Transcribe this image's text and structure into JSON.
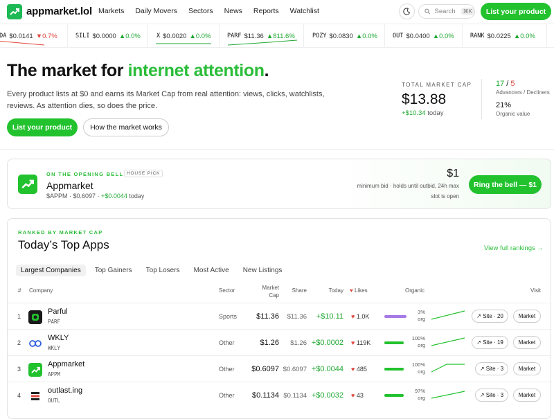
{
  "nav": {
    "brand": "appmarket.lol",
    "links": [
      "Markets",
      "Daily Movers",
      "Sectors",
      "News",
      "Reports",
      "Watchlist"
    ],
    "search_placeholder": "Search",
    "search_shortcut": "⌘K",
    "cta": "List your product"
  },
  "ticker": [
    {
      "sym": "QDA",
      "price": "$0.0141",
      "change": "▼0.7%",
      "dir": "down"
    },
    {
      "sym": "SILI",
      "price": "$0.0000",
      "change": "▲0.0%",
      "dir": "up"
    },
    {
      "sym": "X",
      "price": "$0.0020",
      "change": "▲0.0%",
      "dir": "up"
    },
    {
      "sym": "PARF",
      "price": "$11.36",
      "change": "▲811.6%",
      "dir": "up"
    },
    {
      "sym": "POZY",
      "price": "$0.0830",
      "change": "▲0.0%",
      "dir": "up"
    },
    {
      "sym": "OUT",
      "price": "$0.0400",
      "change": "▲0.0%",
      "dir": "up"
    },
    {
      "sym": "RANK",
      "price": "$0.0225",
      "change": "▲0.0%",
      "dir": "up"
    }
  ],
  "hero": {
    "title_prefix": "The market for ",
    "title_highlight": "internet attention",
    "title_suffix": ".",
    "subtitle": "Every product lists at $0 and earns its Market Cap from real attention: views, clicks, watchlists, reviews. As attention dies, so does the price.",
    "primary_cta": "List your product",
    "secondary_cta": "How the market works"
  },
  "stats": {
    "market_cap_label": "TOTAL MARKET CAP",
    "market_cap": "$13.88",
    "market_cap_change": "+$10.34",
    "market_cap_period": "today",
    "advancers": "17",
    "decliners": "5",
    "adv_label": "Advancers / Decliners",
    "organic": "21%",
    "organic_label": "Organic value"
  },
  "bell": {
    "kicker": "ON THE OPENING BELL",
    "badge": "HOUSE PICK",
    "name": "Appmarket",
    "ticker": "$APPM",
    "price": "$0.6097",
    "change": "+$0.0044",
    "period": "today",
    "bid": "$1",
    "note1": "minimum bid · holds until outbid, 24h max",
    "note2": "slot is open",
    "cta": "Ring the bell — $1"
  },
  "rankings": {
    "kicker": "RANKED BY MARKET CAP",
    "title": "Today’s Top Apps",
    "link": "View full rankings →",
    "tabs": [
      "Largest Companies",
      "Top Gainers",
      "Top Losers",
      "Most Active",
      "New Listings"
    ],
    "headers": {
      "rank": "#",
      "company": "Company",
      "sector": "Sector",
      "mcap1": "Market",
      "mcap2": "Cap",
      "share": "Share",
      "today": "Today",
      "likes": "Likes",
      "organic": "Organic",
      "visit": "Visit"
    },
    "rows": [
      {
        "rank": "1",
        "name": "Parful",
        "ticker": "PARF",
        "sector": "Sports",
        "mcap": "$11.36",
        "share": "$11.36",
        "today": "+$10.11",
        "likes": "1.0K",
        "organic_pct": "3%",
        "organic_fraction": 0.03,
        "org_label": "org",
        "site": "↗ Site · 20",
        "market": "Market",
        "bar_color": "#a678e6"
      },
      {
        "rank": "2",
        "name": "WKLY",
        "ticker": "WKLY",
        "sector": "Other",
        "mcap": "$1.26",
        "share": "$1.26",
        "today": "+$0.0002",
        "likes": "119K",
        "organic_pct": "100%",
        "organic_fraction": 1.0,
        "org_label": "org",
        "site": "↗ Site · 19",
        "market": "Market",
        "bar_color": "#22c22e"
      },
      {
        "rank": "3",
        "name": "Appmarket",
        "ticker": "APPM",
        "sector": "Other",
        "mcap": "$0.6097",
        "share": "$0.6097",
        "today": "+$0.0044",
        "likes": "485",
        "organic_pct": "100%",
        "organic_fraction": 1.0,
        "org_label": "org",
        "site": "↗ Site · 3",
        "market": "Market",
        "bar_color": "#22c22e"
      },
      {
        "rank": "4",
        "name": "outlast.ing",
        "ticker": "OUTL",
        "sector": "Other",
        "mcap": "$0.1134",
        "share": "$0.1134",
        "today": "+$0.0032",
        "likes": "43",
        "organic_pct": "97%",
        "organic_fraction": 0.97,
        "org_label": "org",
        "site": "↗ Site · 3",
        "market": "Market",
        "bar_color": "#22c22e"
      }
    ]
  },
  "colors": {
    "accent": "#22c22e",
    "up": "#1fa833",
    "down": "#e0463c"
  }
}
